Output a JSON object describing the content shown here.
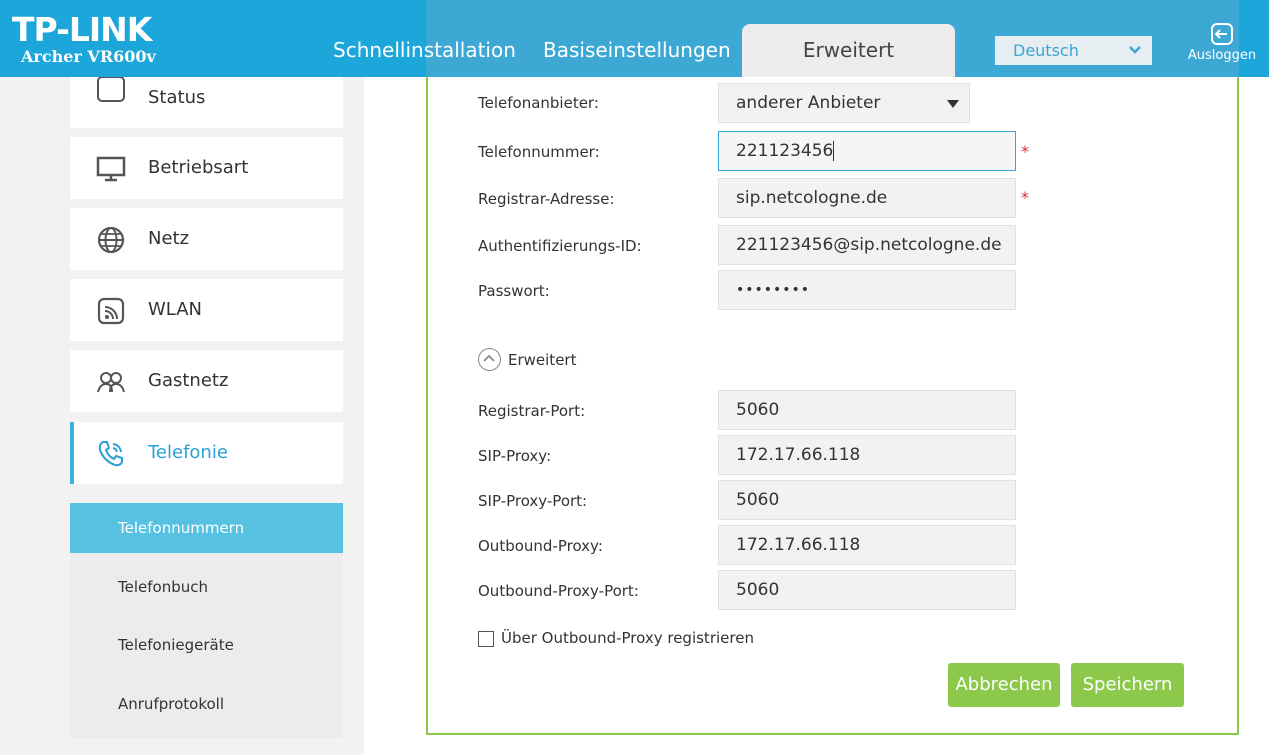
{
  "header": {
    "logo": "TP-LINK",
    "model": "Archer VR600v",
    "nav": [
      "Schnellinstallation",
      "Basiseinstellungen"
    ],
    "nav_active": "Erweitert",
    "language": "Deutsch",
    "logout": "Ausloggen"
  },
  "sidebar": {
    "partial_item": "Status",
    "items": [
      {
        "label": "Betriebsart",
        "icon": "monitor-icon"
      },
      {
        "label": "Netz",
        "icon": "globe-icon"
      },
      {
        "label": "WLAN",
        "icon": "wifi-icon"
      },
      {
        "label": "Gastnetz",
        "icon": "guests-icon"
      },
      {
        "label": "Telefonie",
        "icon": "phone-icon"
      }
    ],
    "submenu": [
      "Telefonnummern",
      "Telefonbuch",
      "Telefoniegeräte",
      "Anrufprotokoll"
    ]
  },
  "form": {
    "provider_label": "Telefonanbieter:",
    "provider_value": "anderer Anbieter",
    "phone_label": "Telefonnummer:",
    "phone_value": "221123456",
    "registrar_label": "Registrar-Adresse:",
    "registrar_value": "sip.netcologne.de",
    "auth_label": "Authentifizierungs-ID:",
    "auth_value": "221123456@sip.netcologne.de",
    "password_label": "Passwort:",
    "password_value": "••••••••",
    "required_marker": "*",
    "advanced_toggle": "Erweitert",
    "registrar_port_label": "Registrar-Port:",
    "registrar_port_value": "5060",
    "sip_proxy_label": "SIP-Proxy:",
    "sip_proxy_value": "172.17.66.118",
    "sip_proxy_port_label": "SIP-Proxy-Port:",
    "sip_proxy_port_value": "5060",
    "outbound_proxy_label": "Outbound-Proxy:",
    "outbound_proxy_value": "172.17.66.118",
    "outbound_proxy_port_label": "Outbound-Proxy-Port:",
    "outbound_proxy_port_value": "5060",
    "outbound_register_label": "Über Outbound-Proxy registrieren",
    "outbound_register_checked": false
  },
  "buttons": {
    "cancel": "Abbrechen",
    "save": "Speichern"
  },
  "colors": {
    "brand": "#1da6d9",
    "accent_green": "#8cc84a",
    "submenu_active": "#56c1e1"
  }
}
